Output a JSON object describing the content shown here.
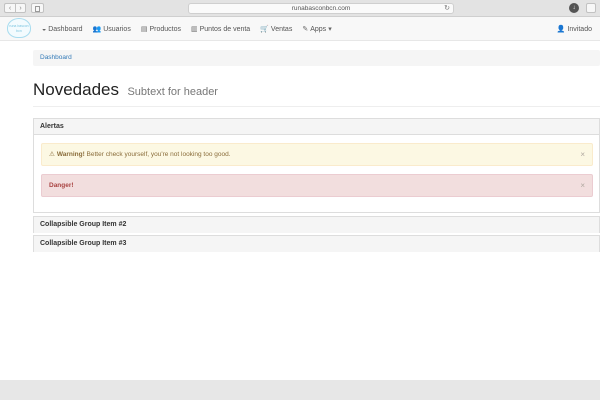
{
  "browser": {
    "url": "runabasconbcn.com",
    "reload_glyph": "↻",
    "back_glyph": "‹",
    "forward_glyph": "›",
    "download_glyph": "↓"
  },
  "logo": {
    "text": "runa bascon bcn"
  },
  "nav": {
    "items": [
      {
        "label": "Dashboard",
        "icon": "dashboard-icon",
        "glyph": "◒"
      },
      {
        "label": "Usuarios",
        "icon": "users-icon",
        "glyph": "👥"
      },
      {
        "label": "Productos",
        "icon": "products-icon",
        "glyph": "▤"
      },
      {
        "label": "Puntos de venta",
        "icon": "store-icon",
        "glyph": "▥"
      },
      {
        "label": "Ventas",
        "icon": "cart-icon",
        "glyph": "🛒"
      },
      {
        "label": "Apps",
        "icon": "apps-icon",
        "glyph": "✎",
        "caret": "▾"
      }
    ],
    "user": {
      "label": "Invitado",
      "glyph": "👤"
    }
  },
  "breadcrumb": {
    "label": "Dashboard"
  },
  "header": {
    "title": "Novedades",
    "subtitle": "Subtext for header"
  },
  "panels": {
    "alerts_title": "Alertas",
    "warning": {
      "icon_glyph": "⚠",
      "strong": "Warning!",
      "text": " Better check yourself, you're not looking too good.",
      "close": "×"
    },
    "danger": {
      "strong": "Danger!",
      "close": "×"
    },
    "group2_title": "Collapsible Group Item #2",
    "group3_title": "Collapsible Group Item #3"
  },
  "colors": {
    "link": "#337ab7",
    "warning_bg": "#fcf8e3",
    "danger_bg": "#f2dede"
  }
}
